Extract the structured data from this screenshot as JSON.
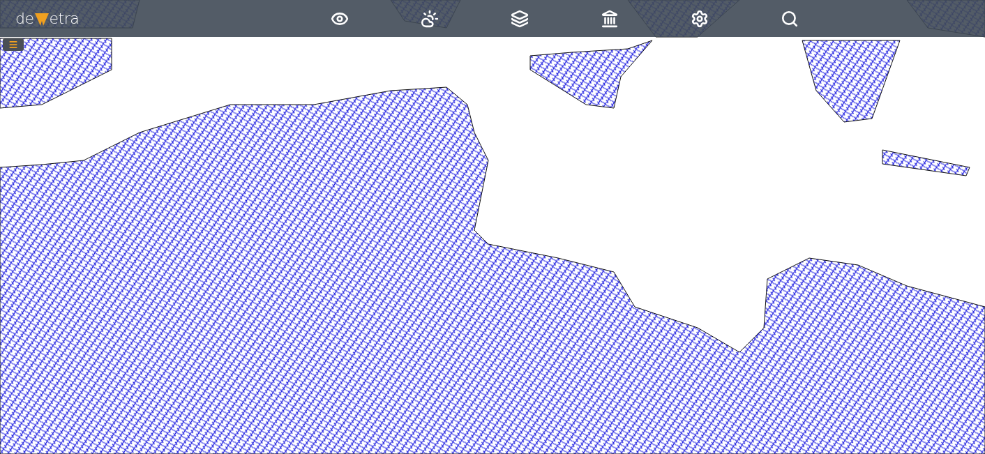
{
  "header": {
    "logo": {
      "prefix": "de",
      "suffix": "etra"
    }
  }
}
